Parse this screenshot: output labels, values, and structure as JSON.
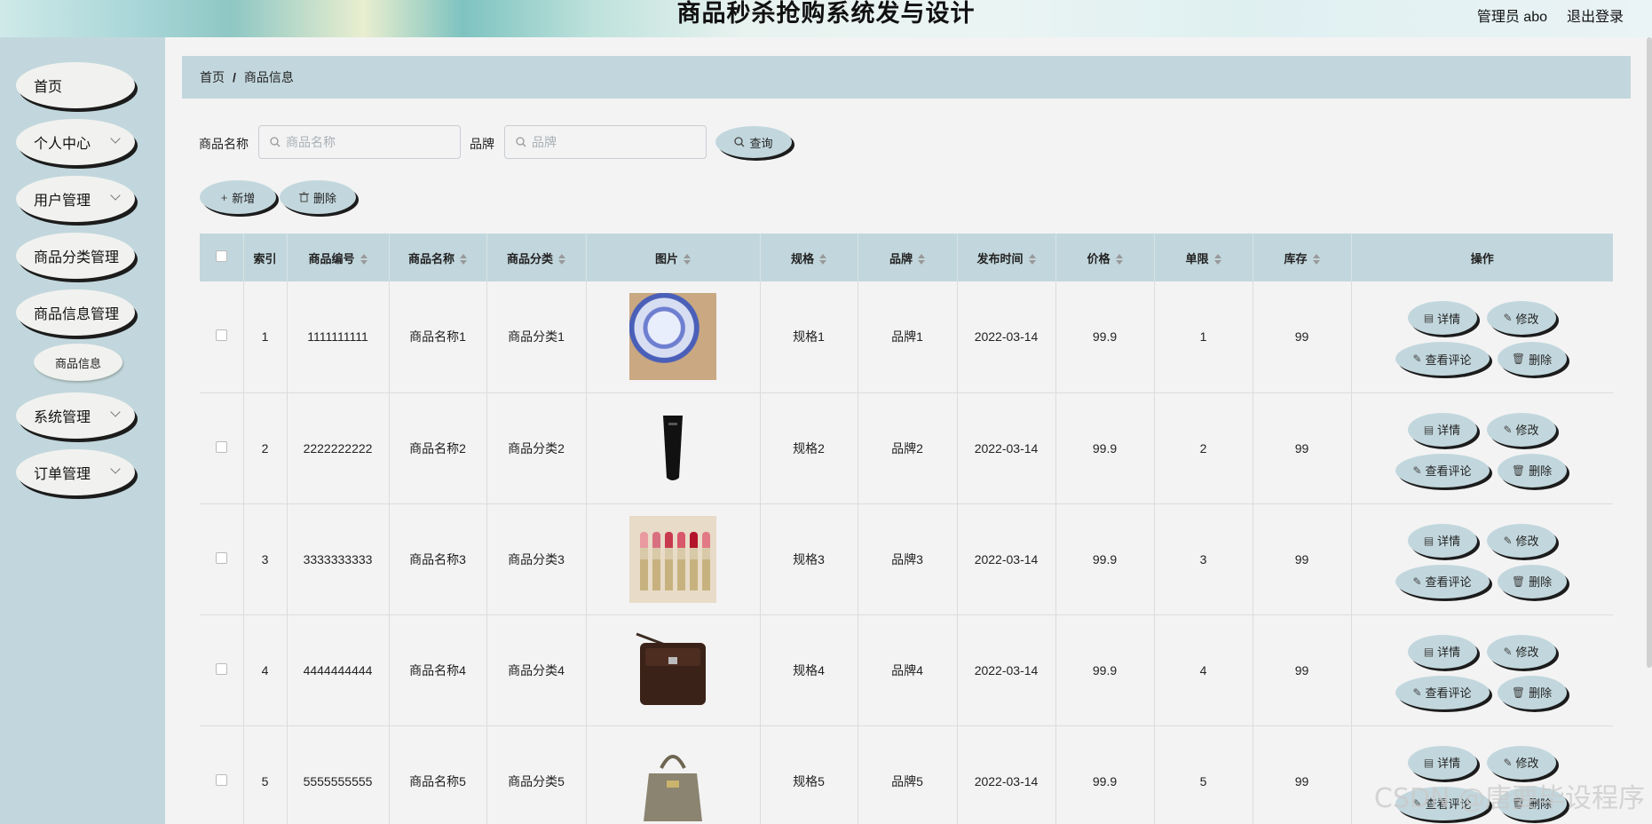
{
  "header": {
    "title": "商品秒杀抢购系统发与设计",
    "admin": "管理员 abo",
    "logout": "退出登录"
  },
  "sidebar": {
    "items": [
      {
        "label": "首页"
      },
      {
        "label": "个人中心"
      },
      {
        "label": "用户管理"
      },
      {
        "label": "商品分类管理"
      },
      {
        "label": "商品信息管理"
      },
      {
        "label": "系统管理"
      },
      {
        "label": "订单管理"
      }
    ],
    "sub_item": "商品信息"
  },
  "breadcrumb": {
    "home": "首页",
    "sep": "/",
    "current": "商品信息"
  },
  "search": {
    "name_label": "商品名称",
    "name_placeholder": "商品名称",
    "brand_label": "品牌",
    "brand_placeholder": "品牌",
    "query_label": "查询"
  },
  "toolbar": {
    "add_label": "新增",
    "delete_label": "删除"
  },
  "table": {
    "headers": [
      "索引",
      "商品编号",
      "商品名称",
      "商品分类",
      "图片",
      "规格",
      "品牌",
      "发布时间",
      "价格",
      "单限",
      "库存",
      "操作"
    ],
    "rows": [
      {
        "index": "1",
        "code": "1111111111",
        "name": "商品名称1",
        "category": "商品分类1",
        "image": "candy-image",
        "spec": "规格1",
        "brand": "品牌1",
        "date": "2022-03-14",
        "price": "99.9",
        "limit": "1",
        "stock": "99"
      },
      {
        "index": "2",
        "code": "2222222222",
        "name": "商品名称2",
        "category": "商品分类2",
        "image": "tube-image",
        "spec": "规格2",
        "brand": "品牌2",
        "date": "2022-03-14",
        "price": "99.9",
        "limit": "2",
        "stock": "99"
      },
      {
        "index": "3",
        "code": "3333333333",
        "name": "商品名称3",
        "category": "商品分类3",
        "image": "lipstick-image",
        "spec": "规格3",
        "brand": "品牌3",
        "date": "2022-03-14",
        "price": "99.9",
        "limit": "3",
        "stock": "99"
      },
      {
        "index": "4",
        "code": "4444444444",
        "name": "商品名称4",
        "category": "商品分类4",
        "image": "bag-image",
        "spec": "规格4",
        "brand": "品牌4",
        "date": "2022-03-14",
        "price": "99.9",
        "limit": "4",
        "stock": "99"
      },
      {
        "index": "5",
        "code": "5555555555",
        "name": "商品名称5",
        "category": "商品分类5",
        "image": "handbag-image",
        "spec": "规格5",
        "brand": "品牌5",
        "date": "2022-03-14",
        "price": "99.9",
        "limit": "5",
        "stock": "99"
      }
    ],
    "ops": {
      "detail": "详情",
      "edit": "修改",
      "comments": "查看评论",
      "delete": "删除"
    }
  },
  "watermark": "CSDN @唐要毕设程序",
  "colors": {
    "accent": "#c2d7dd",
    "sidebar": "#c2d7dd",
    "background": "#f3f3f3"
  }
}
